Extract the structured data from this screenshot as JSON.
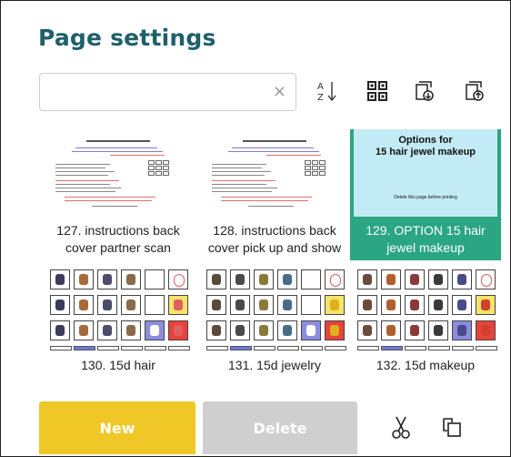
{
  "title": "Page settings",
  "search": {
    "value": "",
    "placeholder": "",
    "clear_glyph": "×"
  },
  "toolbar": {
    "sort_icon": "sort-alpha-down-icon",
    "grid_icon": "grid-view-icon",
    "import_icon": "import-page-icon",
    "export_icon": "export-page-icon"
  },
  "pages": [
    {
      "label": "127. instructions back cover partner scan",
      "type": "document"
    },
    {
      "label": "128. instructions back cover pick up and show",
      "type": "document"
    },
    {
      "label": "129. OPTION 15 hair jewel makeup",
      "type": "options",
      "selected": true,
      "thumb_title": "Options for\n15 hair jewel makeup",
      "thumb_note": "Delete this page before printing"
    },
    {
      "label": "130. 15d hair",
      "type": "grid"
    },
    {
      "label": "131. 15d jewelry",
      "type": "grid"
    },
    {
      "label": "132. 15d makeup",
      "type": "grid"
    }
  ],
  "buttons": {
    "new": "New",
    "delete": "Delete"
  },
  "actions": {
    "cut_icon": "scissors-icon",
    "copy_icon": "copy-icon"
  },
  "colors": {
    "title": "#1e5f6b",
    "selected": "#2aa682",
    "new_button": "#efc827",
    "delete_button": "#cfcfcf"
  }
}
